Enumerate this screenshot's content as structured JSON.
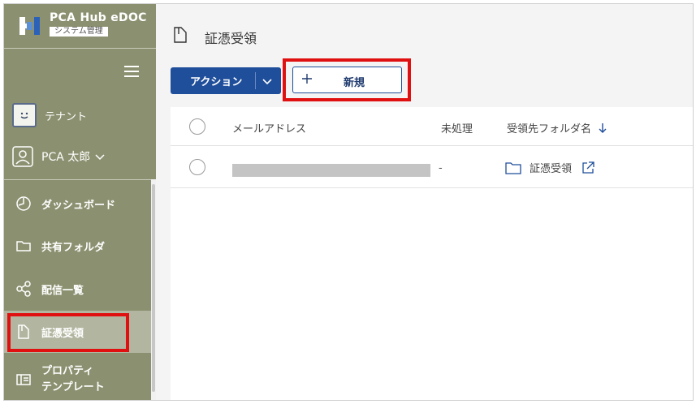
{
  "app": {
    "title": "PCA Hub eDOC",
    "subtitle": "システム管理"
  },
  "sidebar": {
    "tenant_label": "テナント",
    "user_label": "PCA 太郎",
    "items": [
      {
        "label": "ダッシュボード",
        "icon": "clock-icon"
      },
      {
        "label": "共有フォルダ",
        "icon": "folder-icon"
      },
      {
        "label": "配信一覧",
        "icon": "share-icon"
      },
      {
        "label": "証憑受領",
        "icon": "document-icon",
        "active": true
      },
      {
        "label_line1": "プロパティ",
        "label_line2": "テンプレート",
        "icon": "template-icon"
      }
    ]
  },
  "page": {
    "title": "証憑受領"
  },
  "toolbar": {
    "action_label": "アクション",
    "new_label": "新規"
  },
  "table": {
    "columns": [
      "メールアドレス",
      "未処理",
      "受領先フォルダ名"
    ],
    "rows": [
      {
        "email": "",
        "pending": "-",
        "folder": "証憑受領"
      }
    ]
  },
  "colors": {
    "sidebar": "#8b9170",
    "active_item": "#b2b59f",
    "primary": "#1f4e9a",
    "highlight": "#e01010"
  }
}
